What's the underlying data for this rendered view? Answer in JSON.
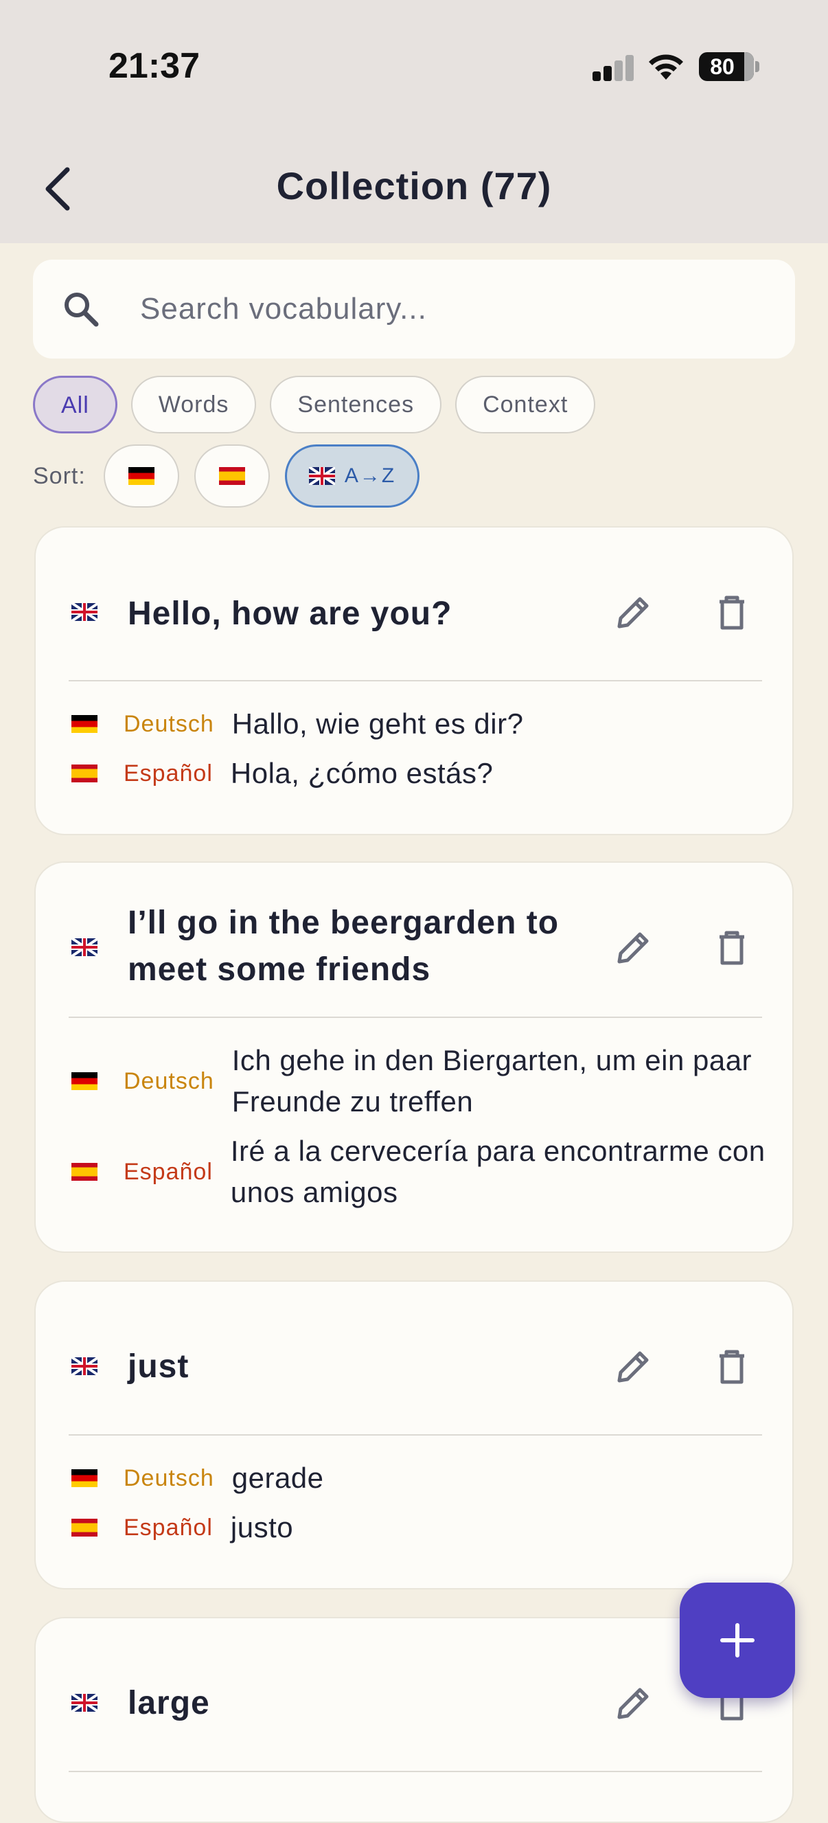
{
  "status_bar": {
    "time": "21:37",
    "battery": "80"
  },
  "header": {
    "title": "Collection (77)"
  },
  "search": {
    "placeholder": "Search vocabulary..."
  },
  "filters": {
    "items": [
      "All",
      "Words",
      "Sentences",
      "Context"
    ],
    "selected": "All"
  },
  "sort": {
    "label": "Sort:",
    "options": [
      {
        "flag": "de"
      },
      {
        "flag": "es"
      },
      {
        "flag": "uk",
        "text": "A→Z",
        "selected": true
      }
    ]
  },
  "entries": [
    {
      "term": "Hello, how are you?",
      "translations": [
        {
          "lang": "Deutsch",
          "text": "Hallo, wie geht es dir?"
        },
        {
          "lang": "Español",
          "text": "Hola, ¿cómo estás?"
        }
      ]
    },
    {
      "term": "I’ll go in the beergarden to meet some friends",
      "translations": [
        {
          "lang": "Deutsch",
          "text": "Ich gehe in den Biergarten, um ein paar Freunde zu treffen"
        },
        {
          "lang": "Español",
          "text": "Iré a la cervecería para encontrarme con unos amigos"
        }
      ]
    },
    {
      "term": "just",
      "translations": [
        {
          "lang": "Deutsch",
          "text": "gerade"
        },
        {
          "lang": "Español",
          "text": "justo"
        }
      ]
    },
    {
      "term": "large"
    }
  ],
  "colors": {
    "accent": "#4f3fc2",
    "deutsch": "#c9850e",
    "espanol": "#c43a18",
    "background": "#f4efe3"
  },
  "icons": [
    "back-arrow-icon",
    "search-icon",
    "pencil-icon",
    "trash-icon",
    "plus-icon"
  ]
}
